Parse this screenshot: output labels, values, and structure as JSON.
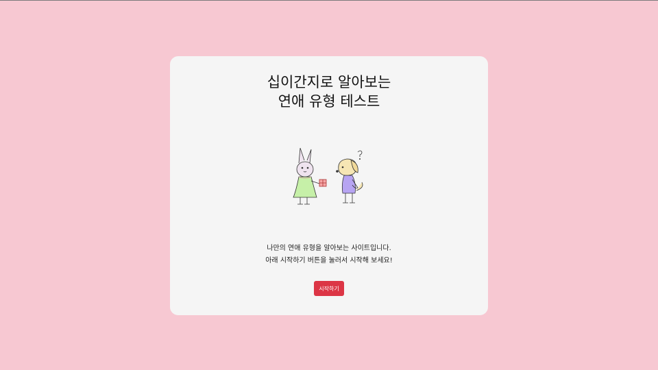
{
  "main": {
    "title_line1": "십이간지로 알아보는",
    "title_line2": "연애 유형 테스트",
    "description_line1": "나만의 연애 유형을 알아보는 사이트입니다.",
    "description_line2": "아래 시작하기 버튼을 눌러서 시작해 보세요!",
    "start_button_label": "시작하기"
  },
  "colors": {
    "page_background": "#f7c8d2",
    "card_background": "#f5f5f5",
    "button_background": "#dc3545",
    "button_text": "#ffffff"
  },
  "icons": {
    "illustration": "rabbit-giving-gift-to-dog-illustration"
  }
}
